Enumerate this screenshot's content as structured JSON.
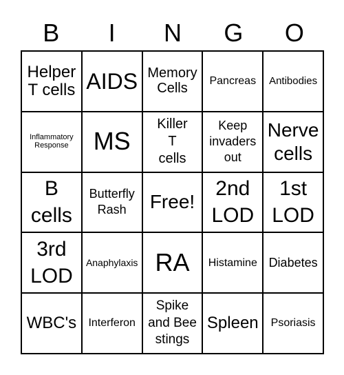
{
  "header": [
    "B",
    "I",
    "N",
    "G",
    "O"
  ],
  "cells": [
    "Helper T cells",
    "AIDS",
    "Memory Cells",
    "Pancreas",
    "Antibodies",
    "Inflammatory Response",
    "MS",
    "Killer T cells",
    "Keep invaders out",
    "Nerve cells",
    "B cells",
    "Butterfly Rash",
    "Free!",
    "2nd LOD",
    "1st LOD",
    "3rd LOD",
    "Anaphylaxis",
    "RA",
    "Histamine",
    "Diabetes",
    "WBC's",
    "Interferon",
    "Spike and Bee stings",
    "Spleen",
    "Psoriasis"
  ]
}
